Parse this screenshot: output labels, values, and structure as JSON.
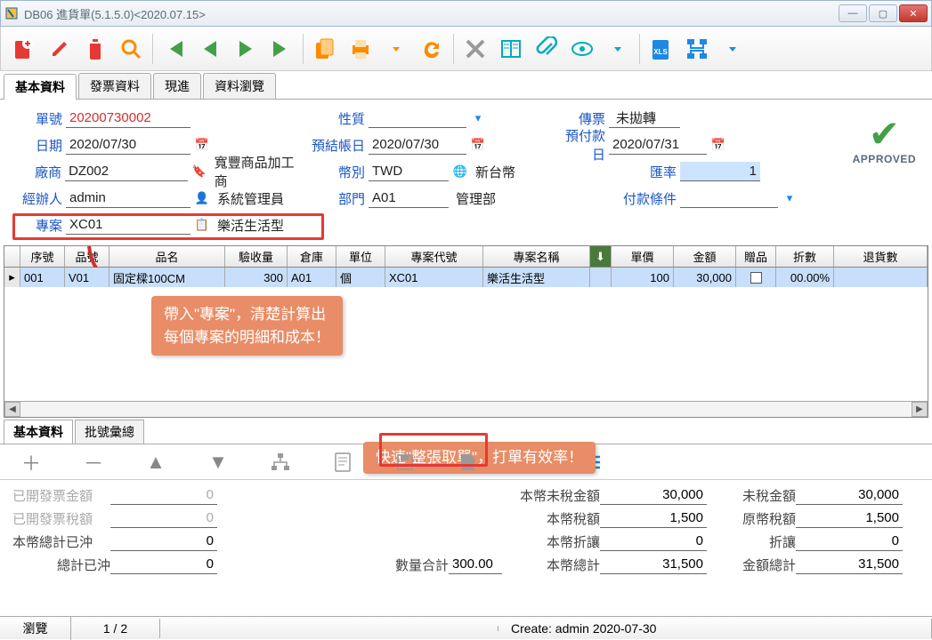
{
  "window": {
    "title": "DB06 進貨單(5.1.5.0)<2020.07.15>"
  },
  "tabs": [
    "基本資料",
    "發票資料",
    "現進",
    "資料瀏覽"
  ],
  "form": {
    "doc_no_label": "單號",
    "doc_no": "20200730002",
    "date_label": "日期",
    "date": "2020/07/30",
    "vendor_label": "廠商",
    "vendor_code": "DZ002",
    "vendor_name": "寬豐商品加工商",
    "handler_label": "經辦人",
    "handler_code": "admin",
    "handler_name": "系統管理員",
    "project_label": "專案",
    "project_code": "XC01",
    "project_name": "樂活生活型",
    "nature_label": "性質",
    "nature": "",
    "pre_post_label": "預結帳日",
    "pre_post": "2020/07/30",
    "currency_label": "幣別",
    "currency_code": "TWD",
    "currency_name": "新台幣",
    "dept_label": "部門",
    "dept_code": "A01",
    "dept_name": "管理部",
    "voucher_label": "傳票",
    "voucher": "未拋轉",
    "prepay_label": "預付款日",
    "prepay": "2020/07/31",
    "rate_label": "匯率",
    "rate": "1",
    "payterm_label": "付款條件",
    "payterm": ""
  },
  "approved_label": "APPROVED",
  "grid": {
    "headers": [
      "序號",
      "品號",
      "品名",
      "驗收量",
      "倉庫",
      "單位",
      "專案代號",
      "專案名稱",
      "",
      "單價",
      "金額",
      "贈品",
      "折數",
      "退貨數"
    ],
    "row": {
      "seq": "001",
      "item_no": "V01",
      "item_name": "固定樑100CM",
      "qty": "300",
      "wh": "A01",
      "unit": "個",
      "proj_code": "XC01",
      "proj_name": "樂活生活型",
      "price": "100",
      "amount": "30,000",
      "gift": "",
      "discount": "00.00%"
    }
  },
  "callout1_line1": "帶入\"專案\"，清楚計算出",
  "callout1_line2": "每個專案的明細和成本！",
  "callout2": "快速\"整張取單\"，打單有效率！",
  "subtabs": [
    "基本資料",
    "批號彙總"
  ],
  "summary": {
    "invoiced_amt_label": "已開發票金額",
    "invoiced_amt": "0",
    "invoiced_tax_label": "已開發票稅額",
    "invoiced_tax": "0",
    "local_settled_label": "本幣總計已沖",
    "local_settled": "0",
    "settled_label": "總計已沖",
    "settled": "0",
    "qty_total_label": "數量合計",
    "qty_total": "300.00",
    "local_untaxed_label": "本幣未稅金額",
    "local_untaxed": "30,000",
    "local_tax_label": "本幣稅額",
    "local_tax": "1,500",
    "local_allowance_label": "本幣折讓",
    "local_allowance": "0",
    "local_total_label": "本幣總計",
    "local_total": "31,500",
    "untaxed_label": "未稅金額",
    "untaxed": "30,000",
    "orig_tax_label": "原幣稅額",
    "orig_tax": "1,500",
    "allowance_label": "折讓",
    "allowance": "0",
    "amount_total_label": "金額總計",
    "amount_total": "31,500"
  },
  "status": {
    "mode": "瀏覽",
    "page": "1 / 2",
    "create": "Create: admin 2020-07-30"
  }
}
